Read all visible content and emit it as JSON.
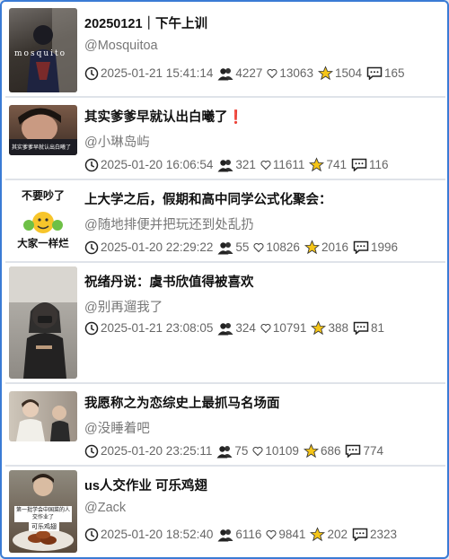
{
  "posts": [
    {
      "title": "20250121｜下午上训",
      "author": "@Mosquitoa",
      "time": "2025-01-21 15:41:14",
      "views": "4227",
      "likes": "13063",
      "favorites": "1504",
      "comments": "165",
      "thumb_caption": "mosquito"
    },
    {
      "title": "其实爹爹早就认出白曦了",
      "title_suffix": "❗",
      "author": "@小琳岛屿",
      "time": "2025-01-20 16:06:54",
      "views": "321",
      "likes": "11611",
      "favorites": "741",
      "comments": "116",
      "thumb_caption": "其实爹爹早就认出白曦了"
    },
    {
      "title": "上大学之后，假期和高中同学公式化聚会：",
      "author": "@随地排便并把玩还到处乱扔",
      "time": "2025-01-20 22:29:22",
      "views": "55",
      "likes": "10826",
      "favorites": "2016",
      "comments": "1996",
      "thumb_top": "不要吵了",
      "thumb_bottom": "大家一样烂"
    },
    {
      "title": "祝绪丹说：虞书欣值得被喜欢",
      "author": "@别再遛我了",
      "time": "2025-01-21 23:08:05",
      "views": "324",
      "likes": "10791",
      "favorites": "388",
      "comments": "81"
    },
    {
      "title": "我愿称之为恋综史上最抓马名场面",
      "author": "@没睡着吧",
      "time": "2025-01-20 23:25:11",
      "views": "75",
      "likes": "10109",
      "favorites": "686",
      "comments": "774"
    },
    {
      "title": "us人交作业 可乐鸡翅",
      "author": "@Zack",
      "time": "2025-01-20 18:52:40",
      "views": "6116",
      "likes": "9841",
      "favorites": "202",
      "comments": "2323",
      "thumb_top": "第一批学会中国菜的人交作业了",
      "thumb_bottom": "可乐鸡翅"
    }
  ]
}
